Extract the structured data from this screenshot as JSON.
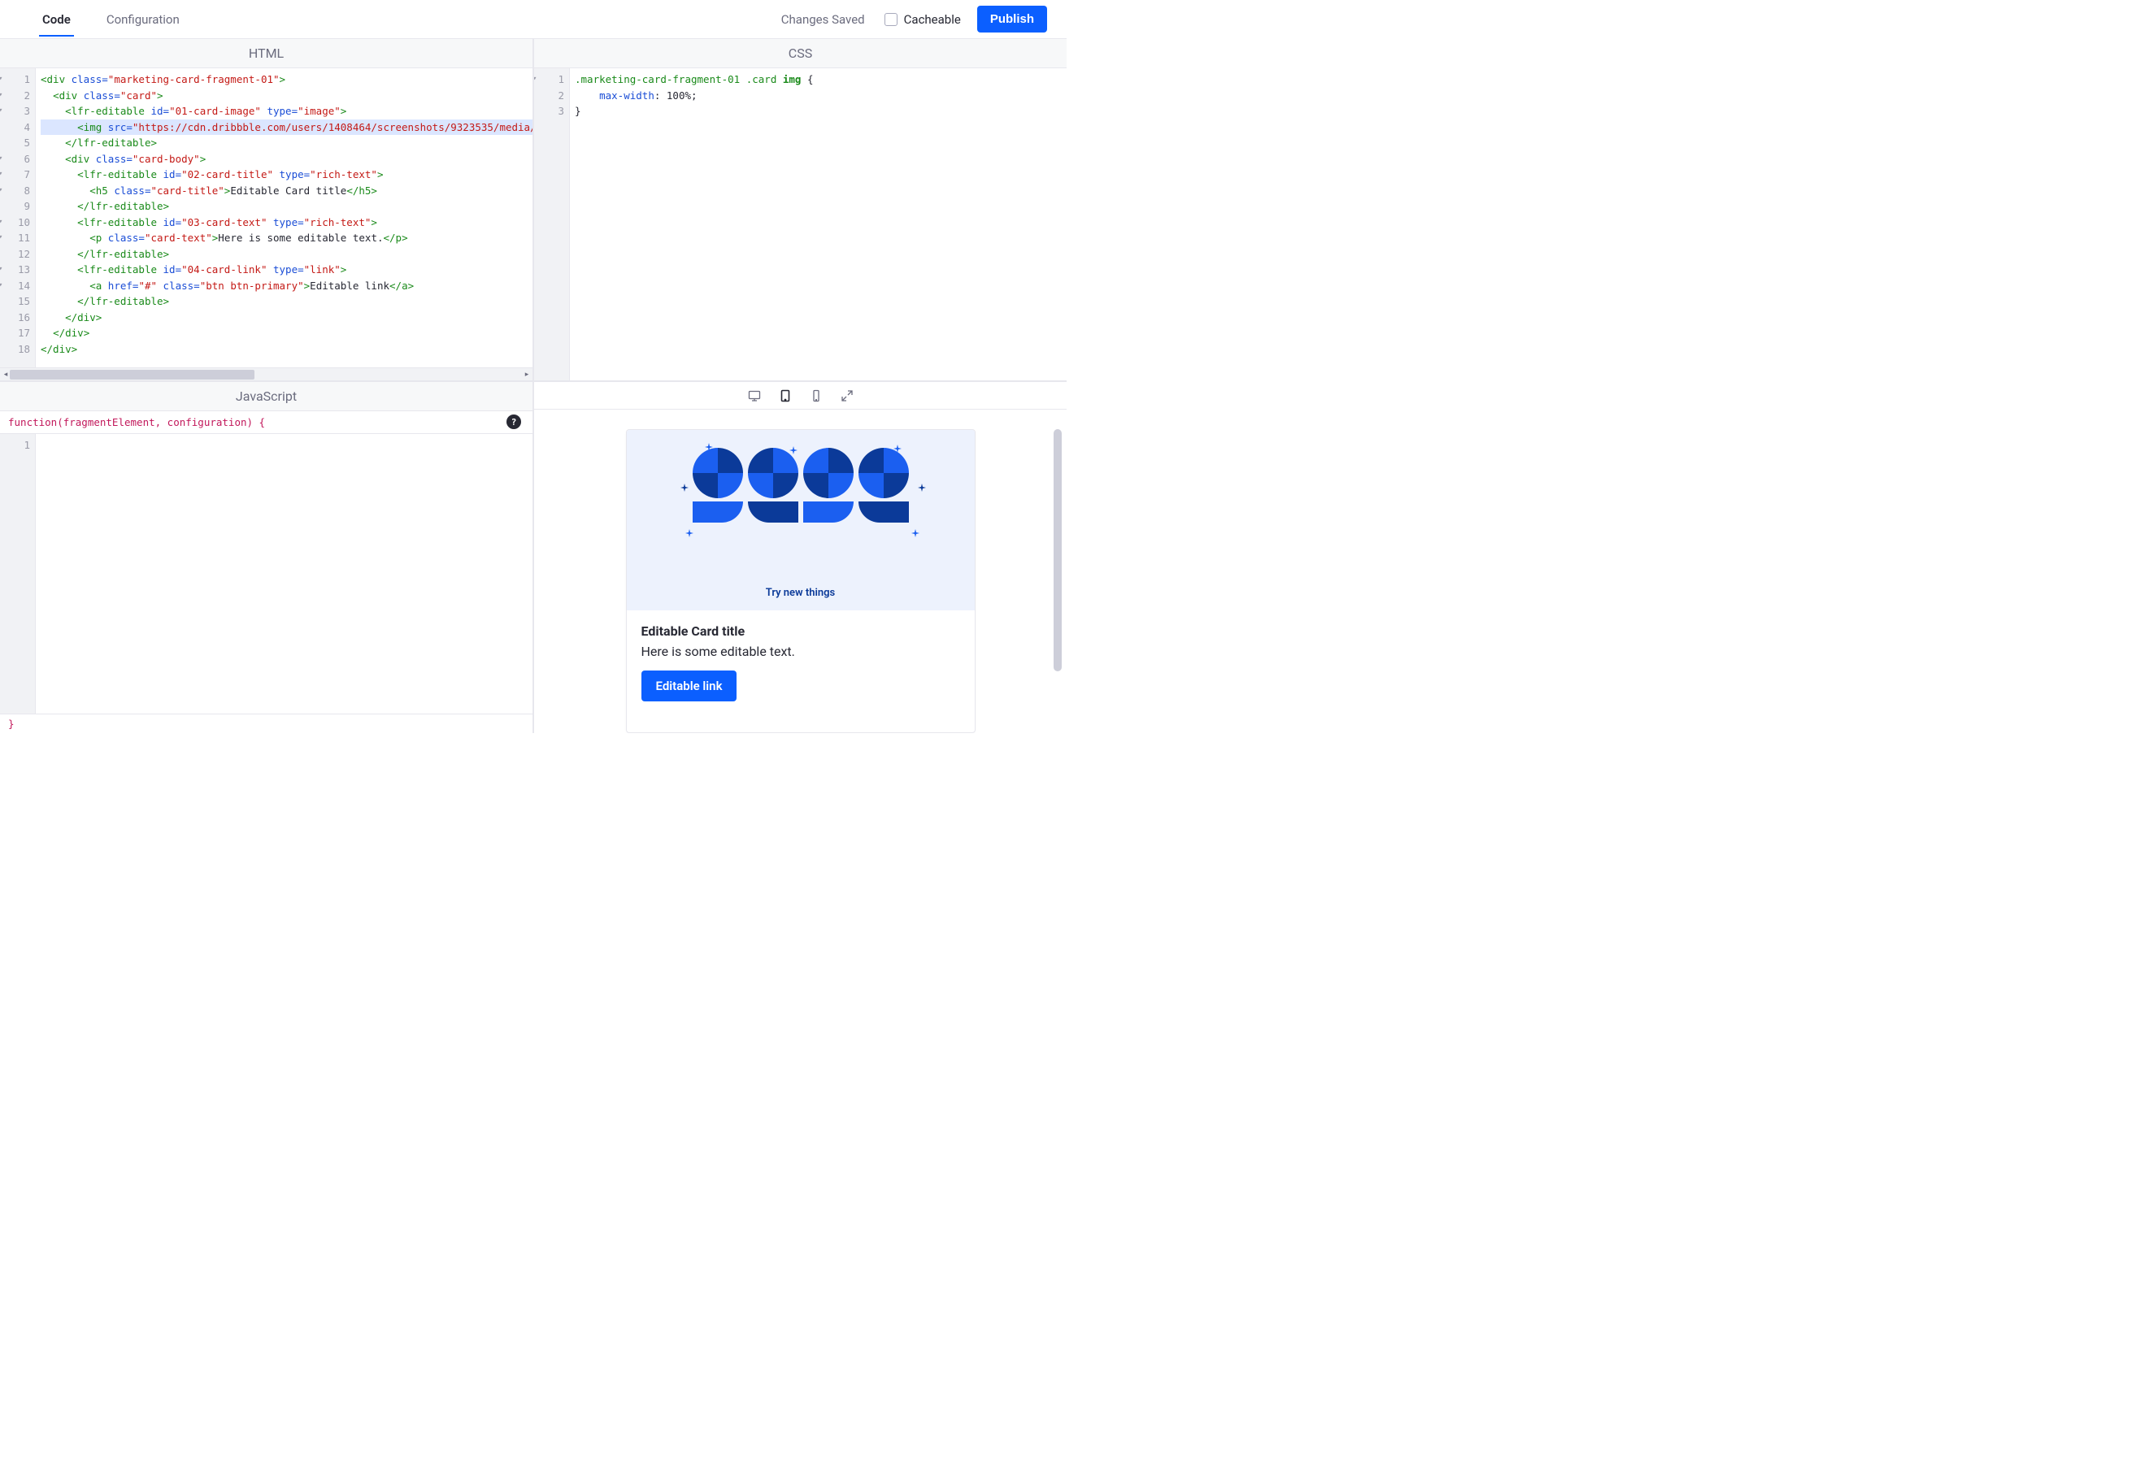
{
  "topbar": {
    "tabs": [
      {
        "label": "Code",
        "active": true
      },
      {
        "label": "Configuration",
        "active": false
      }
    ],
    "status": "Changes Saved",
    "cacheable_label": "Cacheable",
    "publish_label": "Publish"
  },
  "panes": {
    "html_label": "HTML",
    "css_label": "CSS",
    "js_label": "JavaScript"
  },
  "html_editor": {
    "lines": [
      {
        "n": 1,
        "fold": true,
        "hl": false,
        "tokens": [
          {
            "c": "t-tag",
            "t": "<div"
          },
          {
            "c": "t-attr",
            "t": " class="
          },
          {
            "c": "t-str",
            "t": "\"marketing-card-fragment-01\""
          },
          {
            "c": "t-tag",
            "t": ">"
          }
        ]
      },
      {
        "n": 2,
        "fold": true,
        "hl": false,
        "tokens": [
          {
            "c": "",
            "t": "  "
          },
          {
            "c": "t-tag",
            "t": "<div"
          },
          {
            "c": "t-attr",
            "t": " class="
          },
          {
            "c": "t-str",
            "t": "\"card\""
          },
          {
            "c": "t-tag",
            "t": ">"
          }
        ]
      },
      {
        "n": 3,
        "fold": true,
        "hl": false,
        "tokens": [
          {
            "c": "",
            "t": "    "
          },
          {
            "c": "t-tag",
            "t": "<lfr-editable"
          },
          {
            "c": "t-attr",
            "t": " id="
          },
          {
            "c": "t-str",
            "t": "\"01-card-image\""
          },
          {
            "c": "t-attr",
            "t": " type="
          },
          {
            "c": "t-str",
            "t": "\"image\""
          },
          {
            "c": "t-tag",
            "t": ">"
          }
        ]
      },
      {
        "n": 4,
        "fold": false,
        "hl": true,
        "tokens": [
          {
            "c": "",
            "t": "      "
          },
          {
            "c": "t-tag",
            "t": "<img"
          },
          {
            "c": "t-attr",
            "t": " src="
          },
          {
            "c": "t-str",
            "t": "\"https://cdn.dribbble.com/users/1408464/screenshots/9323535/media/a5b9"
          }
        ]
      },
      {
        "n": 5,
        "fold": false,
        "hl": false,
        "tokens": [
          {
            "c": "",
            "t": "    "
          },
          {
            "c": "t-tag",
            "t": "</lfr-editable>"
          }
        ]
      },
      {
        "n": 6,
        "fold": true,
        "hl": false,
        "tokens": [
          {
            "c": "",
            "t": "    "
          },
          {
            "c": "t-tag",
            "t": "<div"
          },
          {
            "c": "t-attr",
            "t": " class="
          },
          {
            "c": "t-str",
            "t": "\"card-body\""
          },
          {
            "c": "t-tag",
            "t": ">"
          }
        ]
      },
      {
        "n": 7,
        "fold": true,
        "hl": false,
        "tokens": [
          {
            "c": "",
            "t": "      "
          },
          {
            "c": "t-tag",
            "t": "<lfr-editable"
          },
          {
            "c": "t-attr",
            "t": " id="
          },
          {
            "c": "t-str",
            "t": "\"02-card-title\""
          },
          {
            "c": "t-attr",
            "t": " type="
          },
          {
            "c": "t-str",
            "t": "\"rich-text\""
          },
          {
            "c": "t-tag",
            "t": ">"
          }
        ]
      },
      {
        "n": 8,
        "fold": true,
        "hl": false,
        "tokens": [
          {
            "c": "",
            "t": "        "
          },
          {
            "c": "t-tag",
            "t": "<h5"
          },
          {
            "c": "t-attr",
            "t": " class="
          },
          {
            "c": "t-str",
            "t": "\"card-title\""
          },
          {
            "c": "t-tag",
            "t": ">"
          },
          {
            "c": "t-txt",
            "t": "Editable Card title"
          },
          {
            "c": "t-tag",
            "t": "</h5>"
          }
        ]
      },
      {
        "n": 9,
        "fold": false,
        "hl": false,
        "tokens": [
          {
            "c": "",
            "t": "      "
          },
          {
            "c": "t-tag",
            "t": "</lfr-editable>"
          }
        ]
      },
      {
        "n": 10,
        "fold": true,
        "hl": false,
        "tokens": [
          {
            "c": "",
            "t": "      "
          },
          {
            "c": "t-tag",
            "t": "<lfr-editable"
          },
          {
            "c": "t-attr",
            "t": " id="
          },
          {
            "c": "t-str",
            "t": "\"03-card-text\""
          },
          {
            "c": "t-attr",
            "t": " type="
          },
          {
            "c": "t-str",
            "t": "\"rich-text\""
          },
          {
            "c": "t-tag",
            "t": ">"
          }
        ]
      },
      {
        "n": 11,
        "fold": true,
        "hl": false,
        "tokens": [
          {
            "c": "",
            "t": "        "
          },
          {
            "c": "t-tag",
            "t": "<p"
          },
          {
            "c": "t-attr",
            "t": " class="
          },
          {
            "c": "t-str",
            "t": "\"card-text\""
          },
          {
            "c": "t-tag",
            "t": ">"
          },
          {
            "c": "t-txt",
            "t": "Here is some editable text."
          },
          {
            "c": "t-tag",
            "t": "</p>"
          }
        ]
      },
      {
        "n": 12,
        "fold": false,
        "hl": false,
        "tokens": [
          {
            "c": "",
            "t": "      "
          },
          {
            "c": "t-tag",
            "t": "</lfr-editable>"
          }
        ]
      },
      {
        "n": 13,
        "fold": true,
        "hl": false,
        "tokens": [
          {
            "c": "",
            "t": "      "
          },
          {
            "c": "t-tag",
            "t": "<lfr-editable"
          },
          {
            "c": "t-attr",
            "t": " id="
          },
          {
            "c": "t-str",
            "t": "\"04-card-link\""
          },
          {
            "c": "t-attr",
            "t": " type="
          },
          {
            "c": "t-str",
            "t": "\"link\""
          },
          {
            "c": "t-tag",
            "t": ">"
          }
        ]
      },
      {
        "n": 14,
        "fold": true,
        "hl": false,
        "tokens": [
          {
            "c": "",
            "t": "        "
          },
          {
            "c": "t-tag",
            "t": "<a"
          },
          {
            "c": "t-attr",
            "t": " href="
          },
          {
            "c": "t-str",
            "t": "\"#\""
          },
          {
            "c": "t-attr",
            "t": " class="
          },
          {
            "c": "t-str",
            "t": "\"btn btn-primary\""
          },
          {
            "c": "t-tag",
            "t": ">"
          },
          {
            "c": "t-txt",
            "t": "Editable link"
          },
          {
            "c": "t-tag",
            "t": "</a>"
          }
        ]
      },
      {
        "n": 15,
        "fold": false,
        "hl": false,
        "tokens": [
          {
            "c": "",
            "t": "      "
          },
          {
            "c": "t-tag",
            "t": "</lfr-editable>"
          }
        ]
      },
      {
        "n": 16,
        "fold": false,
        "hl": false,
        "tokens": [
          {
            "c": "",
            "t": "    "
          },
          {
            "c": "t-tag",
            "t": "</div>"
          }
        ]
      },
      {
        "n": 17,
        "fold": false,
        "hl": false,
        "tokens": [
          {
            "c": "",
            "t": "  "
          },
          {
            "c": "t-tag",
            "t": "</div>"
          }
        ]
      },
      {
        "n": 18,
        "fold": false,
        "hl": false,
        "tokens": [
          {
            "c": "t-tag",
            "t": "</div>"
          }
        ]
      }
    ]
  },
  "css_editor": {
    "lines": [
      {
        "n": 1,
        "fold": true,
        "tokens": [
          {
            "c": "t-sel",
            "t": ".marketing-card-fragment-01 .card "
          },
          {
            "c": "t-sel t-img",
            "t": "img"
          },
          {
            "c": "",
            "t": " {"
          }
        ]
      },
      {
        "n": 2,
        "fold": false,
        "tokens": [
          {
            "c": "",
            "t": "    "
          },
          {
            "c": "t-prop",
            "t": "max-width"
          },
          {
            "c": "",
            "t": ": "
          },
          {
            "c": "t-val",
            "t": "100%"
          },
          {
            "c": "",
            "t": ";"
          }
        ]
      },
      {
        "n": 3,
        "fold": false,
        "tokens": [
          {
            "c": "",
            "t": "}"
          }
        ]
      }
    ]
  },
  "js_editor": {
    "header": "function(fragmentElement, configuration) {",
    "footer": "}",
    "lines": [
      {
        "n": 1,
        "tokens": []
      }
    ]
  },
  "preview": {
    "slogan": "Try new things",
    "card_title": "Editable Card title",
    "card_text": "Here is some editable text.",
    "card_link": "Editable link"
  }
}
